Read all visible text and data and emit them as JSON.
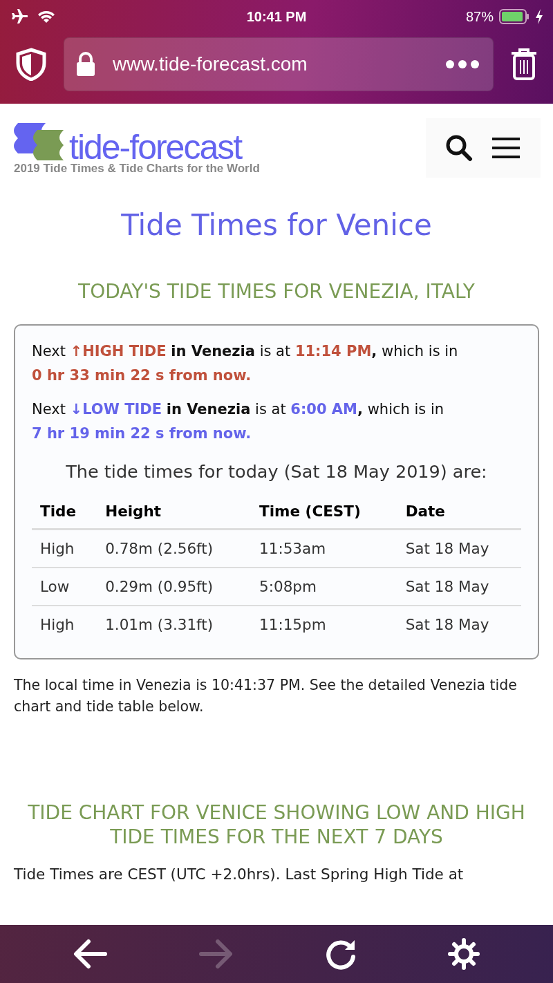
{
  "status_bar": {
    "time": "10:41 PM",
    "battery": "87%"
  },
  "browser": {
    "url": "www.tide-forecast.com"
  },
  "header": {
    "logo": "tide-forecast",
    "tagline": "2019 Tide Times & Tide Charts for the World"
  },
  "title": "Tide Times for Venice",
  "today_heading": "TODAY'S TIDE TIMES FOR VENEZIA, ITALY",
  "next_tides": [
    {
      "kind": "high",
      "prefix": "Next",
      "arrow": "↑",
      "label": "HIGH TIDE",
      "place": "in Venezia",
      "mid": "is at",
      "time": "11:14 PM",
      "suffix": ", which is in",
      "countdown": "0 hr 33 min 22 s from now."
    },
    {
      "kind": "low",
      "prefix": "Next",
      "arrow": "↓",
      "label": "LOW TIDE",
      "place": "in Venezia",
      "mid": "is at",
      "time": "6:00 AM",
      "suffix": ", which is in",
      "countdown": "7 hr 19 min 22 s from now."
    }
  ],
  "today_caption": "The tide times for today (Sat 18 May 2019) are:",
  "table": {
    "columns": [
      "Tide",
      "Height",
      "Time (CEST)",
      "Date"
    ],
    "rows": [
      [
        "High",
        "0.78m (2.56ft)",
        "11:53am",
        "Sat 18 May"
      ],
      [
        "Low",
        "0.29m (0.95ft)",
        "5:08pm",
        "Sat 18 May"
      ],
      [
        "High",
        "1.01m (3.31ft)",
        "11:15pm",
        "Sat 18 May"
      ]
    ]
  },
  "local_time_note": "The local time in Venezia is 10:41:37 PM. See the detailed Venezia tide chart and tide table below.",
  "chart_heading": "TIDE CHART FOR VENICE SHOWING LOW AND HIGH TIDE TIMES FOR THE NEXT 7 DAYS",
  "chart_note": "Tide Times are CEST (UTC +2.0hrs). Last Spring High Tide at",
  "toolbar": {
    "forward_disabled": true
  }
}
